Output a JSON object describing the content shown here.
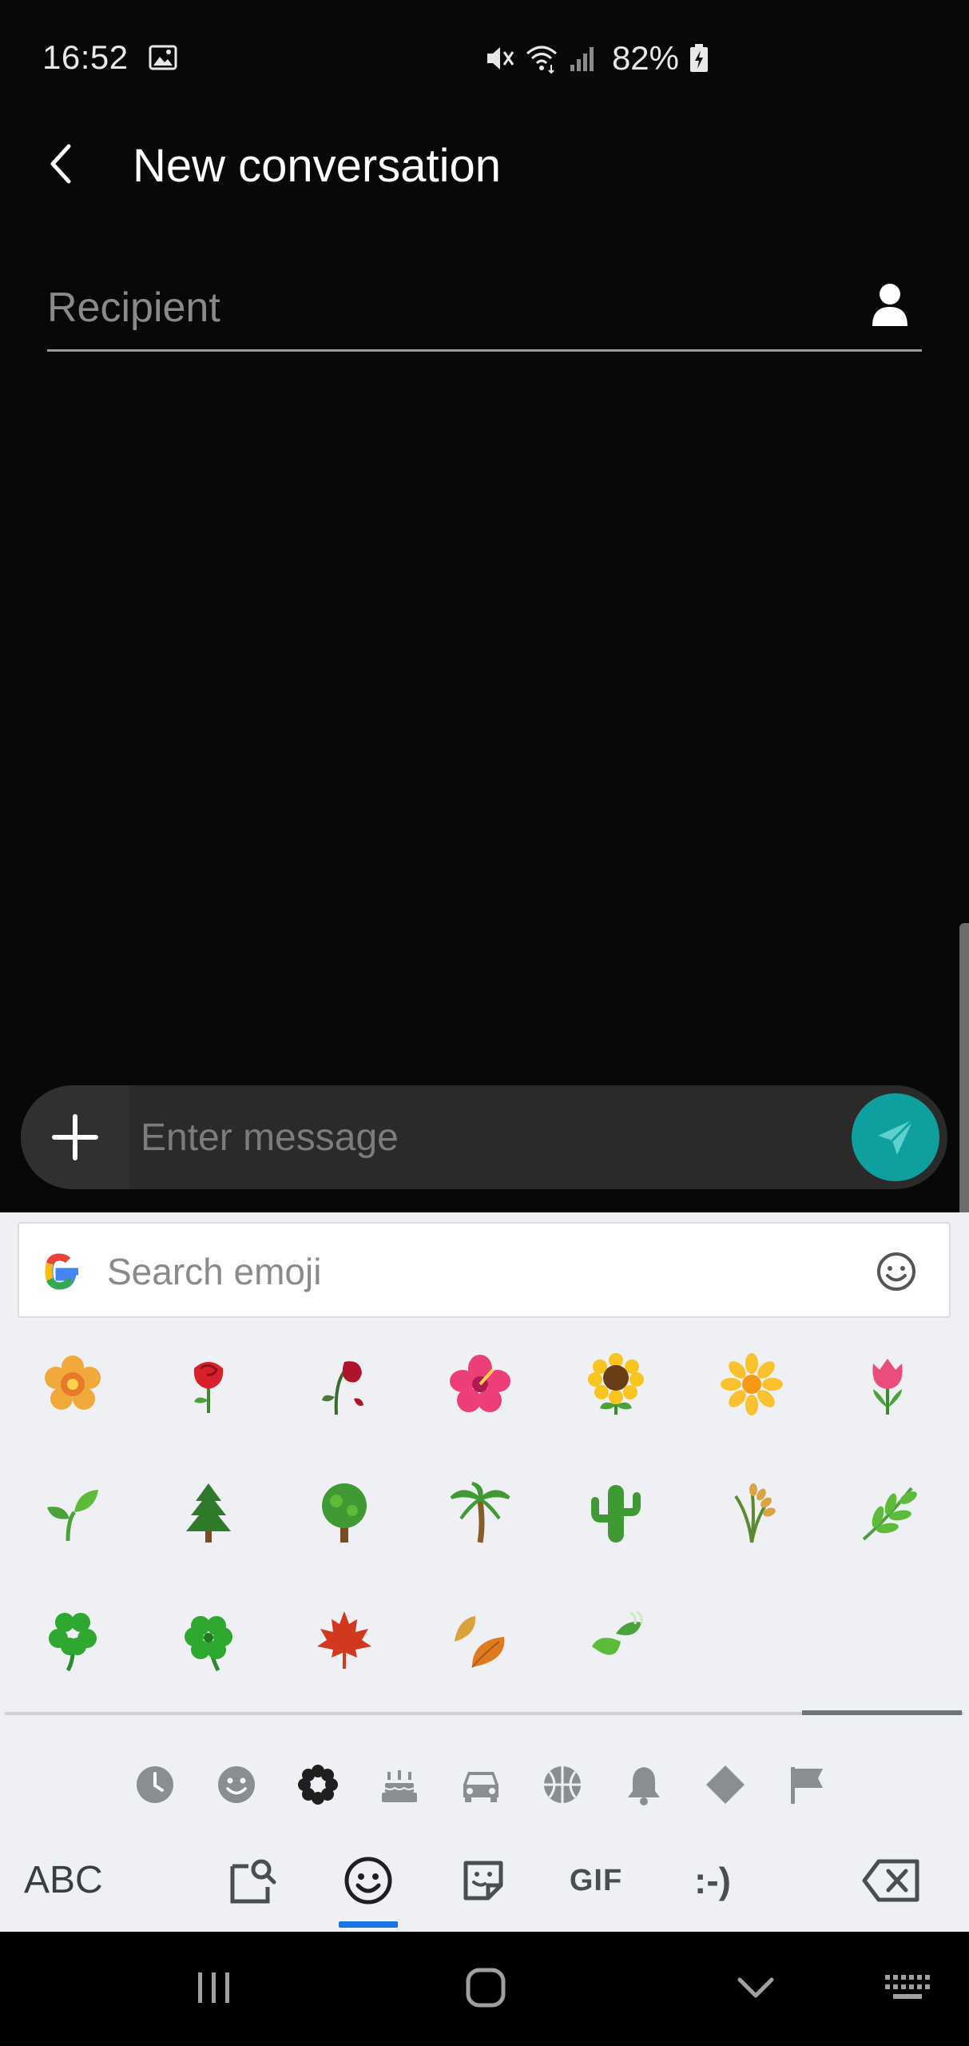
{
  "status_bar": {
    "time": "16:52",
    "battery_percent": "82%",
    "icons": [
      "image-notification-icon",
      "mute-icon",
      "wifi-icon",
      "signal-icon",
      "battery-charging-icon"
    ]
  },
  "header": {
    "title": "New conversation",
    "back_icon": "back-arrow-icon"
  },
  "recipient": {
    "placeholder": "Recipient",
    "value": "",
    "contact_icon": "person-icon"
  },
  "composer": {
    "placeholder": "Enter message",
    "value": "",
    "attach_icon": "plus-icon",
    "send_icon": "send-icon",
    "send_color": "#0f9f9e"
  },
  "keyboard": {
    "search": {
      "placeholder": "Search emoji",
      "value": "",
      "logo": "google-logo-icon",
      "face_icon": "smiley-icon"
    },
    "emoji_rows": [
      [
        "🏵️",
        "🌹",
        "🥀",
        "🌺",
        "🌻",
        "🌼",
        "🌷"
      ],
      [
        "🌱",
        "🌲",
        "🌳",
        "🌴",
        "🌵",
        "🌾",
        "🌿"
      ],
      [
        "☘️",
        "🍀",
        "🍁",
        "🍂",
        "🍃"
      ]
    ],
    "categories": [
      "recent-icon",
      "smileys-icon",
      "nature-icon",
      "food-icon",
      "travel-icon",
      "activities-icon",
      "objects-icon",
      "symbols-icon",
      "flags-icon"
    ],
    "active_category": "nature-icon",
    "bottom_row": {
      "abc_label": "ABC",
      "gif_label": "GIF",
      "emoticon_label": ":-)",
      "active_tab": "emoji"
    },
    "accent_color": "#1a73e8"
  },
  "nav_bar": {
    "buttons": [
      "recents-icon",
      "home-icon",
      "hide-keyboard-icon",
      "keyboard-switch-icon"
    ]
  }
}
